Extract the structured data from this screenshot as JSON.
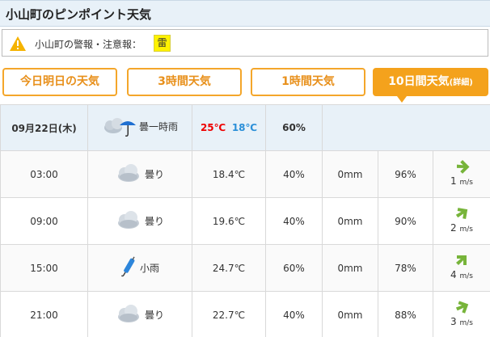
{
  "header": {
    "title": "小山町のピンポイント天気"
  },
  "warning": {
    "label": "小山町の警報・注意報：",
    "badge": "雷"
  },
  "tabs": [
    {
      "label": "今日明日の天気"
    },
    {
      "label": "3時間天気"
    },
    {
      "label": "1時間天気"
    },
    {
      "label": "10日間天気",
      "suffix": "(詳細)"
    }
  ],
  "summary": {
    "date": "09月22日(木)",
    "weather": "曇一時雨",
    "high": "25℃",
    "low": "18℃",
    "pop": "60%"
  },
  "rows": [
    {
      "time": "03:00",
      "weather": "曇り",
      "icon": "cloud-icon",
      "temp": "18.4℃",
      "pop": "40%",
      "precip": "0mm",
      "humidity": "96%",
      "wind_speed": "1",
      "wind_unit": "m/s",
      "wind_icon": "wind-arrow-icon"
    },
    {
      "time": "09:00",
      "weather": "曇り",
      "icon": "cloud-icon",
      "temp": "19.6℃",
      "pop": "40%",
      "precip": "0mm",
      "humidity": "90%",
      "wind_speed": "2",
      "wind_unit": "m/s",
      "wind_icon": "wind-arrow-icon"
    },
    {
      "time": "15:00",
      "weather": "小雨",
      "icon": "umbrella-icon",
      "temp": "24.7℃",
      "pop": "60%",
      "precip": "0mm",
      "humidity": "78%",
      "wind_speed": "4",
      "wind_unit": "m/s",
      "wind_icon": "wind-arrow-icon"
    },
    {
      "time": "21:00",
      "weather": "曇り",
      "icon": "cloud-icon",
      "temp": "22.7℃",
      "pop": "40%",
      "precip": "0mm",
      "humidity": "88%",
      "wind_speed": "3",
      "wind_unit": "m/s",
      "wind_icon": "wind-arrow-icon"
    }
  ],
  "colors": {
    "tab_border": "#f4a62a",
    "tab_active": "#f4a21c",
    "high_temp": "#e00000",
    "low_temp": "#2a8fd8",
    "badge": "#fff200",
    "wind_arrow": "#77b43a"
  }
}
